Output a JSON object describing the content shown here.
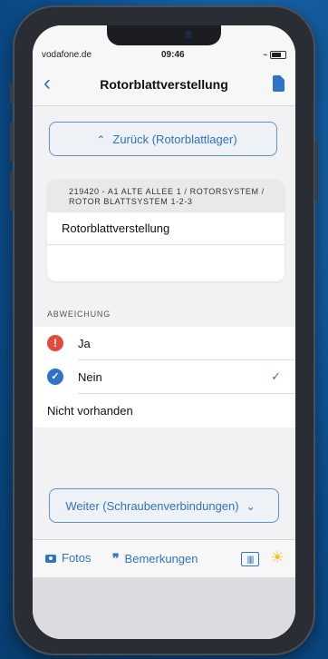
{
  "status_bar": {
    "carrier": "vodafone.de",
    "time": "09:46"
  },
  "nav": {
    "title": "Rotorblattverstellung"
  },
  "back_button_label": "Zurück (Rotorblattlager)",
  "card": {
    "path": "219420 - A1 ALTE ALLEE 1 / ROTORSYSTEM / ROTOR BLATTSYSTEM 1-2-3",
    "title": "Rotorblattverstellung"
  },
  "section": {
    "label": "ABWEICHUNG"
  },
  "options": [
    {
      "label": "Ja",
      "icon": "warning-icon"
    },
    {
      "label": "Nein",
      "icon": "checked-icon",
      "selected": true
    },
    {
      "label": "Nicht vorhanden"
    }
  ],
  "next_button_label": "Weiter (Schraubenverbindungen)",
  "toolbar": {
    "photos": "Fotos",
    "remarks": "Bemerkungen"
  },
  "colors": {
    "accent": "#2f73c7",
    "warning": "#e04b3c",
    "background": "#0c4f8e"
  }
}
